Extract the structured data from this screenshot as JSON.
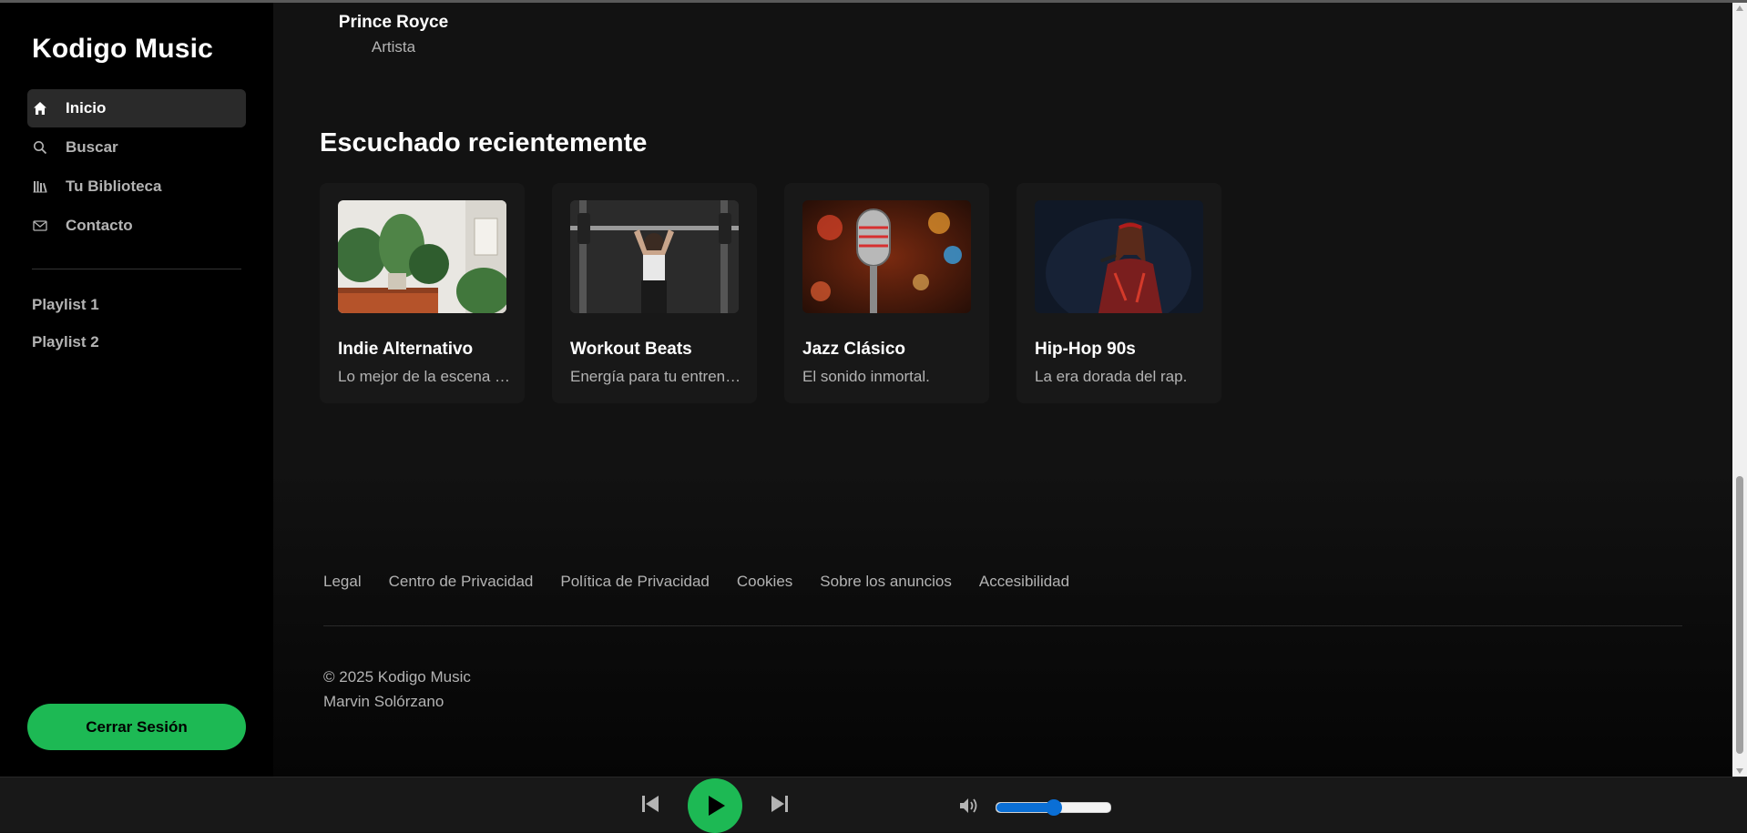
{
  "app": {
    "name": "Kodigo Music"
  },
  "sidebar": {
    "nav": [
      {
        "label": "Inicio",
        "icon": "home-icon",
        "active": true
      },
      {
        "label": "Buscar",
        "icon": "search-icon",
        "active": false
      },
      {
        "label": "Tu Biblioteca",
        "icon": "library-icon",
        "active": false
      },
      {
        "label": "Contacto",
        "icon": "mail-icon",
        "active": false
      }
    ],
    "playlists": [
      "Playlist 1",
      "Playlist 2"
    ],
    "logout_label": "Cerrar Sesión"
  },
  "artist": {
    "name": "Prince Royce",
    "role": "Artista"
  },
  "recent": {
    "title": "Escuchado recientemente",
    "cards": [
      {
        "title": "Indie Alternativo",
        "desc": "Lo mejor de la escena indie.",
        "image": "plants-photo"
      },
      {
        "title": "Workout Beats",
        "desc": "Energía para tu entrenamiento.",
        "image": "gym-photo"
      },
      {
        "title": "Jazz Clásico",
        "desc": "El sonido inmortal.",
        "image": "microphone-photo"
      },
      {
        "title": "Hip-Hop 90s",
        "desc": "La era dorada del rap.",
        "image": "singer-photo"
      }
    ]
  },
  "footer": {
    "links": [
      "Legal",
      "Centro de Privacidad",
      "Política de Privacidad",
      "Cookies",
      "Sobre los anuncios",
      "Accesibilidad"
    ],
    "copyright": "© 2025 Kodigo Music",
    "author": "Marvin Solórzano"
  },
  "player": {
    "volume": 0.5
  },
  "colors": {
    "accent": "#1db954",
    "background": "#121212",
    "sidebar": "#000000",
    "volume": "#0a6fd6"
  }
}
